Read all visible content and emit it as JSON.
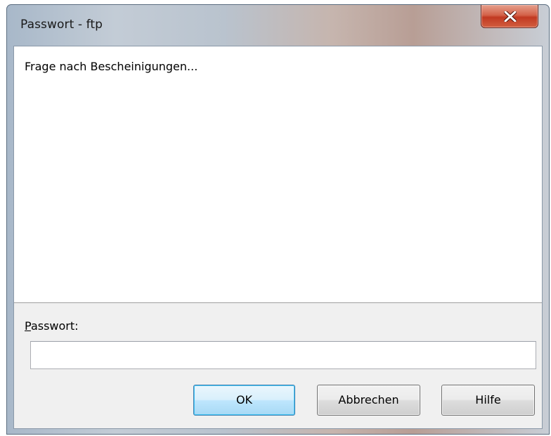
{
  "window": {
    "title": "Passwort - ftp",
    "close_icon": "close-icon"
  },
  "message": {
    "text": "Frage nach Bescheinigungen..."
  },
  "password": {
    "label_accel": "P",
    "label_rest": "asswort:",
    "value": "",
    "placeholder": ""
  },
  "buttons": {
    "ok": "OK",
    "cancel": "Abbrechen",
    "help": "Hilfe"
  },
  "colors": {
    "close_button": "#c13a22",
    "default_button_border": "#3c7fb1"
  }
}
